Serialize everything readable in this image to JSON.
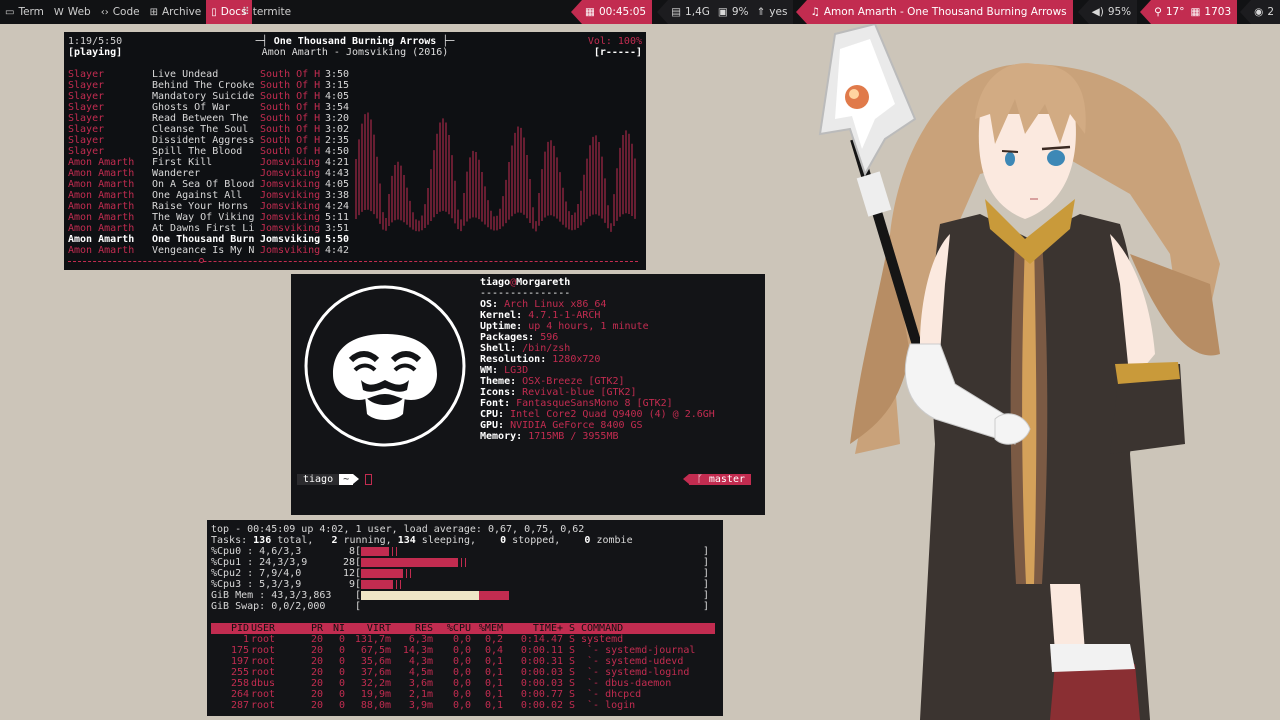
{
  "topbar": {
    "workspaces": [
      {
        "icon": "terminal-icon",
        "label": "Term"
      },
      {
        "icon": "web-icon",
        "label": "Web"
      },
      {
        "icon": "code-icon",
        "label": "Code"
      },
      {
        "icon": "archive-icon",
        "label": "Archive"
      },
      {
        "icon": "docs-icon",
        "label": "Docs",
        "active": true
      }
    ],
    "window_title": "termite",
    "status": {
      "time": "00:45:05",
      "memory": "1,4G",
      "cpu": "9%",
      "updates": "yes",
      "now_playing": "Amon Amarth - One Thousand Burning Arrows",
      "volume": "95%",
      "temperature": "17°",
      "desktop_number": "1703",
      "notifications": "2"
    },
    "accent_color": "#c22c50"
  },
  "music": {
    "elapsed": "1:19/5:50",
    "state": "[playing]",
    "title": "One Thousand Burning Arrows",
    "subtitle": "Amon Amarth - Jomsviking (2016)",
    "volume": "Vol: 100%",
    "flags": "[r-----]",
    "progress": 0.23,
    "tracks": [
      {
        "artist": "Slayer",
        "title": "Live Undead",
        "album": "South Of H",
        "length": "3:50"
      },
      {
        "artist": "Slayer",
        "title": "Behind The Crooke",
        "album": "South Of H",
        "length": "3:15"
      },
      {
        "artist": "Slayer",
        "title": "Mandatory Suicide",
        "album": "South Of H",
        "length": "4:05"
      },
      {
        "artist": "Slayer",
        "title": "Ghosts Of War",
        "album": "South Of H",
        "length": "3:54"
      },
      {
        "artist": "Slayer",
        "title": "Read Between The",
        "album": "South Of H",
        "length": "3:20"
      },
      {
        "artist": "Slayer",
        "title": "Cleanse The Soul",
        "album": "South Of H",
        "length": "3:02"
      },
      {
        "artist": "Slayer",
        "title": "Dissident Aggress",
        "album": "South Of H",
        "length": "2:35"
      },
      {
        "artist": "Slayer",
        "title": "Spill The Blood",
        "album": "South Of H",
        "length": "4:50"
      },
      {
        "artist": "Amon Amarth",
        "title": "First Kill",
        "album": "Jomsviking",
        "length": "4:21"
      },
      {
        "artist": "Amon Amarth",
        "title": "Wanderer",
        "album": "Jomsviking",
        "length": "4:43"
      },
      {
        "artist": "Amon Amarth",
        "title": "On A Sea Of Blood",
        "album": "Jomsviking",
        "length": "4:05"
      },
      {
        "artist": "Amon Amarth",
        "title": "One Against All",
        "album": "Jomsviking",
        "length": "3:38"
      },
      {
        "artist": "Amon Amarth",
        "title": "Raise Your Horns",
        "album": "Jomsviking",
        "length": "4:24"
      },
      {
        "artist": "Amon Amarth",
        "title": "The Way Of Viking",
        "album": "Jomsviking",
        "length": "5:11"
      },
      {
        "artist": "Amon Amarth",
        "title": "At Dawns First Li",
        "album": "Jomsviking",
        "length": "3:51"
      },
      {
        "artist": "Amon Amarth",
        "title": "One Thousand Burn",
        "album": "Jomsviking",
        "length": "5:50",
        "current": true
      },
      {
        "artist": "Amon Amarth",
        "title": "Vengeance Is My N",
        "album": "Jomsviking",
        "length": "4:42"
      }
    ]
  },
  "neofetch": {
    "user": "tiago",
    "at": "@",
    "host": "Morgareth",
    "separator": "---------------",
    "info": [
      {
        "key": "OS:",
        "value": "Arch Linux x86_64"
      },
      {
        "key": "Kernel:",
        "value": "4.7.1-1-ARCH"
      },
      {
        "key": "Uptime:",
        "value": "up 4 hours, 1 minute"
      },
      {
        "key": "Packages:",
        "value": "596"
      },
      {
        "key": "Shell:",
        "value": "/bin/zsh"
      },
      {
        "key": "Resolution:",
        "value": "1280x720"
      },
      {
        "key": "WM:",
        "value": "LG3D"
      },
      {
        "key": "Theme:",
        "value": "OSX-Breeze [GTK2]"
      },
      {
        "key": "Icons:",
        "value": "Revival-blue [GTK2]"
      },
      {
        "key": "Font:",
        "value": "FantasqueSansMono 8 [GTK2]"
      },
      {
        "key": "CPU:",
        "value": "Intel Core2 Quad Q9400 (4) @ 2.6GH"
      },
      {
        "key": "GPU:",
        "value": "NVIDIA GeForce 8400 GS"
      },
      {
        "key": "Memory:",
        "value": "1715MB / 3955MB"
      }
    ],
    "prompt_user": "tiago",
    "prompt_dir": "~",
    "git_branch": "master",
    "git_icon": "git-branch-icon"
  },
  "top": {
    "line1": "top - 00:45:09 up  4:02,  1 user,  load average: 0,67, 0,75, 0,62",
    "tasks": {
      "label": "Tasks:",
      "total": "136",
      "total_label": "total,",
      "running": "2",
      "running_label": "running,",
      "sleeping": "134",
      "sleeping_label": "sleeping,",
      "stopped": "0",
      "stopped_label": "stopped,",
      "zombie": "0",
      "zombie_label": "zombie"
    },
    "cpus": [
      {
        "label": "%Cpu0  :   4,6/3,3",
        "pct": "8",
        "used": 0.08
      },
      {
        "label": "%Cpu1  :  24,3/3,9",
        "pct": "28",
        "used": 0.28
      },
      {
        "label": "%Cpu2  :   7,9/4,0",
        "pct": "12",
        "used": 0.12
      },
      {
        "label": "%Cpu3  :   5,3/3,9",
        "pct": "9",
        "used": 0.09
      }
    ],
    "mem": {
      "label": "GiB Mem : 43,3/3,863",
      "used": 0.433
    },
    "swap": {
      "label": "GiB Swap:  0,0/2,000",
      "used": 0.0
    },
    "header": [
      "PID",
      "USER",
      "PR",
      "NI",
      "VIRT",
      "RES",
      "%CPU",
      "%MEM",
      "TIME+",
      "S",
      "COMMAND"
    ],
    "processes": [
      [
        "1",
        "root",
        "20",
        "0",
        "131,7m",
        "6,3m",
        "0,0",
        "0,2",
        "0:14.47",
        "S",
        "systemd"
      ],
      [
        "175",
        "root",
        "20",
        "0",
        "67,5m",
        "14,3m",
        "0,0",
        "0,4",
        "0:00.11",
        "S",
        " `- systemd-journal"
      ],
      [
        "197",
        "root",
        "20",
        "0",
        "35,6m",
        "4,3m",
        "0,0",
        "0,1",
        "0:00.31",
        "S",
        " `- systemd-udevd"
      ],
      [
        "255",
        "root",
        "20",
        "0",
        "37,6m",
        "4,5m",
        "0,0",
        "0,1",
        "0:00.03",
        "S",
        " `- systemd-logind"
      ],
      [
        "258",
        "dbus",
        "20",
        "0",
        "32,2m",
        "3,6m",
        "0,0",
        "0,1",
        "0:00.03",
        "S",
        " `- dbus-daemon"
      ],
      [
        "264",
        "root",
        "20",
        "0",
        "19,9m",
        "2,1m",
        "0,0",
        "0,1",
        "0:00.77",
        "S",
        " `- dhcpcd"
      ],
      [
        "287",
        "root",
        "20",
        "0",
        "88,0m",
        "3,9m",
        "0,0",
        "0,1",
        "0:00.02",
        "S",
        " `- login"
      ]
    ]
  }
}
